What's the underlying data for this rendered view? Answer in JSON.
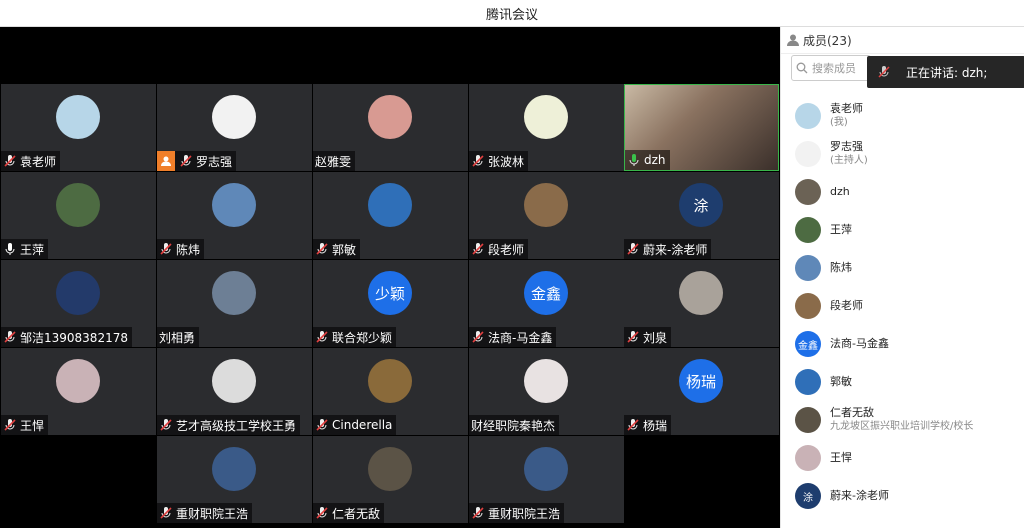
{
  "window": {
    "title": "腾讯会议"
  },
  "members_header": {
    "label": "成员(23)"
  },
  "search": {
    "placeholder": "搜索成员"
  },
  "speaking_popup": {
    "label": "正在讲话: dzh;"
  },
  "tiles": [
    {
      "name": "袁老师",
      "mic": "muted",
      "avatar": "#b7d6e8"
    },
    {
      "name": "罗志强",
      "mic": "muted",
      "avatar": "#f2f2f2",
      "host": true
    },
    {
      "name": "赵雅雯",
      "mic": "none",
      "avatar": "#d89a92"
    },
    {
      "name": "张波林",
      "mic": "muted",
      "avatar": "#eef0d8"
    },
    {
      "name": "dzh",
      "mic": "on",
      "video": true
    },
    {
      "name": "王萍",
      "mic": "on-white",
      "avatar": "#4d6b42"
    },
    {
      "name": "陈炜",
      "mic": "muted",
      "avatar": "#5f88b8"
    },
    {
      "name": "郭敏",
      "mic": "muted",
      "avatar": "#2f6fb8"
    },
    {
      "name": "段老师",
      "mic": "muted",
      "avatar": "#8a6b4a"
    },
    {
      "name": "蔚来-涂老师",
      "mic": "muted",
      "avatar": "#1e3d6e",
      "text": "涂"
    },
    {
      "name": "邹洁13908382178",
      "mic": "muted",
      "avatar": "#233a6a"
    },
    {
      "name": "刘相勇",
      "mic": "none",
      "avatar": "#6d7f95"
    },
    {
      "name": "联合郑少颖",
      "mic": "muted",
      "avatar": "#1e6fe8",
      "text": "少颖"
    },
    {
      "name": "法商-马金鑫",
      "mic": "muted",
      "avatar": "#1e6fe8",
      "text": "金鑫"
    },
    {
      "name": "刘泉",
      "mic": "muted",
      "avatar": "#a9a29a"
    },
    {
      "name": "王悍",
      "mic": "muted",
      "avatar": "#c9b2b6"
    },
    {
      "name": "艺才高级技工学校王勇",
      "mic": "muted",
      "avatar": "#dcdcdc"
    },
    {
      "name": "Cinderella",
      "mic": "muted",
      "avatar": "#8a6a3a"
    },
    {
      "name": "财经职院秦艳杰",
      "mic": "none",
      "avatar": "#e8e2e2"
    },
    {
      "name": "杨瑞",
      "mic": "muted",
      "avatar": "#1e6fe8",
      "text": "杨瑞"
    },
    {
      "name": "重财职院王浩",
      "mic": "muted",
      "avatar": "#3a5a88"
    },
    {
      "name": "仁者无敌",
      "mic": "muted",
      "avatar": "#5b5346"
    },
    {
      "name": "重财职院王浩",
      "mic": "muted",
      "avatar": "#3a5a88"
    }
  ],
  "members": [
    {
      "name": "袁老师",
      "sub": "(我)",
      "avatar": "#b7d6e8"
    },
    {
      "name": "罗志强",
      "sub": "(主持人)",
      "avatar": "#f2f2f2"
    },
    {
      "name": "dzh",
      "sub": "",
      "avatar": "#6b6255"
    },
    {
      "name": "王萍",
      "sub": "",
      "avatar": "#4d6b42"
    },
    {
      "name": "陈炜",
      "sub": "",
      "avatar": "#5f88b8"
    },
    {
      "name": "段老师",
      "sub": "",
      "avatar": "#8a6b4a"
    },
    {
      "name": "法商-马金鑫",
      "sub": "",
      "avatar": "#1e6fe8",
      "text": "金鑫"
    },
    {
      "name": "郭敏",
      "sub": "",
      "avatar": "#2f6fb8"
    },
    {
      "name": "仁者无敌",
      "sub": "九龙坡区振兴职业培训学校/校长",
      "avatar": "#5b5346"
    },
    {
      "name": "王悍",
      "sub": "",
      "avatar": "#c9b2b6"
    },
    {
      "name": "蔚来-涂老师",
      "sub": "",
      "avatar": "#1e3d6e",
      "text": "涂"
    }
  ]
}
